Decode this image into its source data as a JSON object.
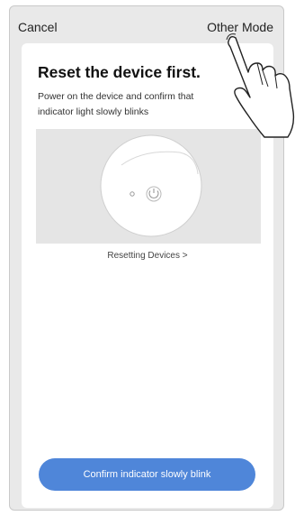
{
  "nav": {
    "cancel_label": "Cancel",
    "other_mode_label": "Other Mode"
  },
  "main": {
    "title": "Reset the device first.",
    "subtitle": "Power on the device and confirm that indicator light slowly blinks",
    "reset_link": "Resetting Devices >",
    "confirm_button": "Confirm indicator slowly blink"
  },
  "icons": {
    "power": "power-icon",
    "indicator": "indicator-light-icon",
    "hand": "pointing-hand-icon"
  },
  "colors": {
    "accent": "#4f86d9",
    "background": "#e9e9e9",
    "card": "#ffffff"
  }
}
